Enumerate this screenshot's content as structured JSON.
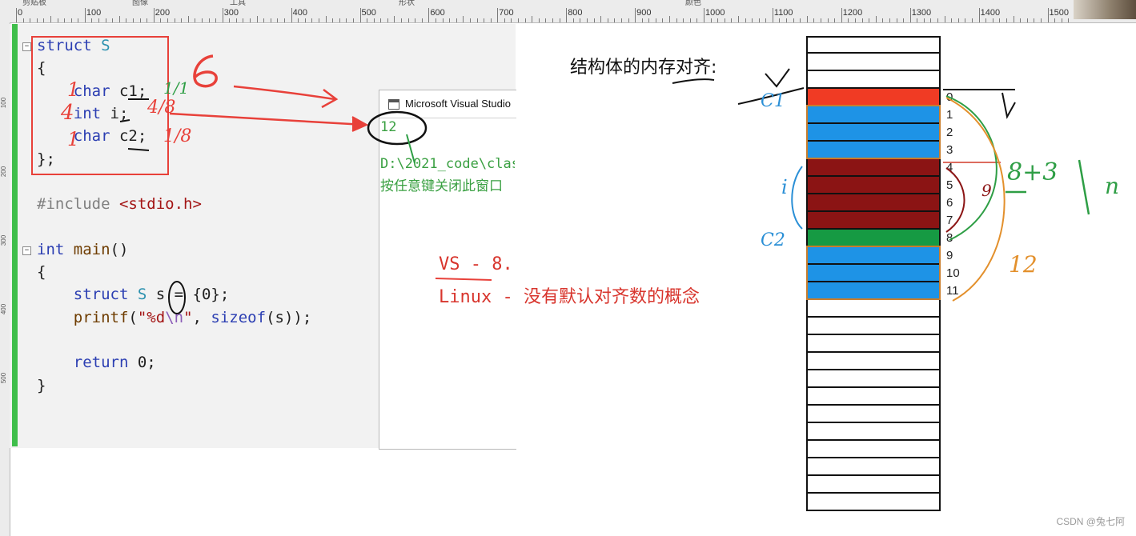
{
  "ruler": {
    "labels": [
      "0",
      "100",
      "200",
      "300",
      "400",
      "500",
      "600",
      "700",
      "800",
      "900",
      "1000",
      "1100",
      "1200",
      "1300",
      "1400",
      "1500"
    ],
    "menu_fragments": [
      "剪贴板",
      "图像",
      "工具",
      "形状",
      "颜色"
    ]
  },
  "left_ruler": {
    "labels": [
      "100",
      "200",
      "300",
      "400",
      "500"
    ]
  },
  "editor": {
    "lines": [
      {
        "tokens": [
          {
            "t": "struct",
            "c": "kw"
          },
          {
            "t": " "
          },
          {
            "t": "S",
            "c": "ty"
          }
        ]
      },
      {
        "tokens": [
          {
            "t": "{"
          }
        ]
      },
      {
        "tokens": [
          {
            "t": "    "
          },
          {
            "t": "char",
            "c": "kw"
          },
          {
            "t": " c1;"
          }
        ]
      },
      {
        "tokens": [
          {
            "t": "    "
          },
          {
            "t": "int",
            "c": "kw"
          },
          {
            "t": " i;"
          }
        ]
      },
      {
        "tokens": [
          {
            "t": "    "
          },
          {
            "t": "char",
            "c": "kw"
          },
          {
            "t": " c2;"
          }
        ]
      },
      {
        "tokens": [
          {
            "t": "};"
          }
        ]
      },
      {
        "tokens": []
      },
      {
        "tokens": [
          {
            "t": "#include",
            "c": "pp"
          },
          {
            "t": " "
          },
          {
            "t": "<stdio.h>",
            "c": "st"
          }
        ]
      },
      {
        "tokens": []
      },
      {
        "tokens": [
          {
            "t": "int",
            "c": "kw"
          },
          {
            "t": " "
          },
          {
            "t": "main",
            "c": "fn"
          },
          {
            "t": "()"
          }
        ]
      },
      {
        "tokens": [
          {
            "t": "{"
          }
        ]
      },
      {
        "tokens": [
          {
            "t": "    "
          },
          {
            "t": "struct",
            "c": "kw"
          },
          {
            "t": " "
          },
          {
            "t": "S",
            "c": "ty"
          },
          {
            "t": " s = {0};"
          }
        ]
      },
      {
        "tokens": [
          {
            "t": "    "
          },
          {
            "t": "printf",
            "c": "fn"
          },
          {
            "t": "("
          },
          {
            "t": "\"%d",
            "c": "st"
          },
          {
            "t": "\\n",
            "c": "esc"
          },
          {
            "t": "\"",
            "c": "st"
          },
          {
            "t": ", "
          },
          {
            "t": "sizeof",
            "c": "kw"
          },
          {
            "t": "(s));"
          }
        ]
      },
      {
        "tokens": []
      },
      {
        "tokens": [
          {
            "t": "    "
          },
          {
            "t": "return",
            "c": "kw"
          },
          {
            "t": " 0;"
          }
        ]
      },
      {
        "tokens": [
          {
            "t": "}"
          }
        ]
      }
    ]
  },
  "console": {
    "title": "Microsoft Visual Studio",
    "output": "12",
    "path_line": "D:\\2021_code\\clas",
    "hint_line": "按任意键关闭此窗口"
  },
  "notes": {
    "vs_line": "VS - 8.",
    "linux_line": "Linux - 没有默认对齐数的概念"
  },
  "diagram": {
    "title": "结构体的内存对齐:",
    "colors": {
      "c1": "#f03b24",
      "pad": "#1e93e6",
      "int": "#8b1414",
      "c2": "#169a43",
      "outline": "#c97d2b"
    },
    "cells": [
      "white",
      "white",
      "white",
      "c1",
      "pad",
      "pad",
      "pad",
      "int",
      "int",
      "int",
      "int",
      "c2",
      "pad",
      "pad",
      "pad",
      "white",
      "white",
      "white",
      "white",
      "white",
      "white",
      "white",
      "white",
      "white",
      "white",
      "white",
      "white"
    ],
    "offsets": [
      "0",
      "1",
      "2",
      "3",
      "4",
      "5",
      "6",
      "7",
      "8",
      "9",
      "10",
      "11"
    ]
  },
  "handwriting": {
    "size_six": "6",
    "c1_offsets": "1/1",
    "i_offsets": "4/8",
    "c2_offsets": "1/8",
    "lhs_one": "1",
    "lhs_four": "4",
    "lhs_one_b": "1",
    "c1_label": "C1",
    "i_label": "i",
    "c2_label": "C2",
    "rhs_expr": "8+3",
    "rhs_12": "12",
    "rhs_9": "9",
    "rhs_n": "n"
  },
  "watermark": "CSDN @兔七阿"
}
